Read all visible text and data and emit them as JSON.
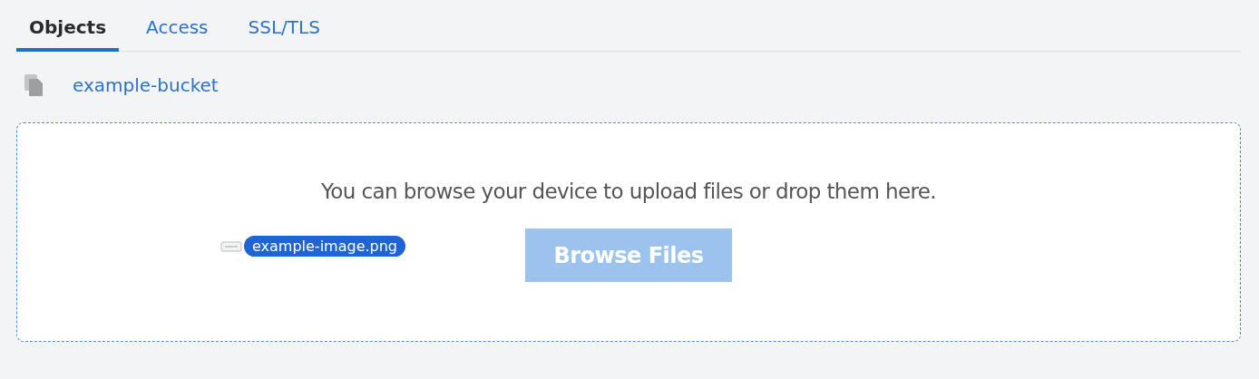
{
  "tabs": [
    {
      "label": "Objects",
      "selected": true
    },
    {
      "label": "Access",
      "selected": false
    },
    {
      "label": "SSL/TLS",
      "selected": false
    }
  ],
  "breadcrumb": {
    "label": "example-bucket"
  },
  "dropzone": {
    "message": "You can browse your device to upload files or drop them here.",
    "button": {
      "label": "Browse Files",
      "disabled": true
    },
    "dragged_file": {
      "name": "example-image.png"
    }
  }
}
